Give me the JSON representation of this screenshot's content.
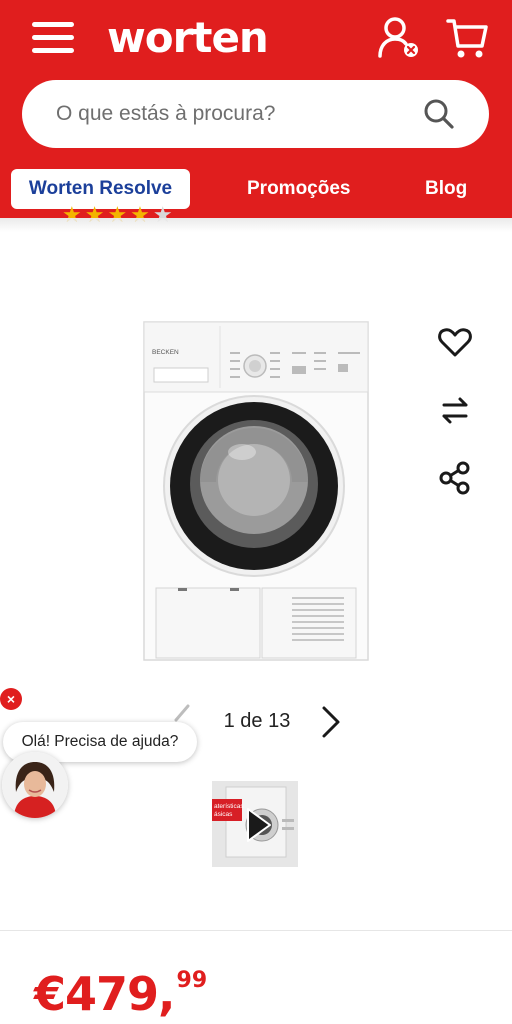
{
  "header": {
    "logo": "worten",
    "search_placeholder": "O que estás à procura?",
    "nav": {
      "resolve": "Worten Resolve",
      "promos": "Promoções",
      "blog": "Blog"
    },
    "icons": [
      "menu-icon",
      "user-icon",
      "cart-icon",
      "search-icon"
    ],
    "colors": {
      "brand": "#e01e1e",
      "nav_active_text": "#1b3f9a"
    }
  },
  "product": {
    "rating": {
      "stars": 4,
      "of": 5
    },
    "image_brand_text": "BECKEN",
    "actions": [
      "heart-icon",
      "compare-icon",
      "share-icon"
    ],
    "gallery": {
      "counter": "1 de 13"
    },
    "thumbnail_text": [
      "aterísticas",
      "ásicas"
    ],
    "price": {
      "main": "€479,",
      "cents": "99"
    }
  },
  "chat": {
    "greeting": "Olá! Precisa de ajuda?",
    "close": "×"
  }
}
